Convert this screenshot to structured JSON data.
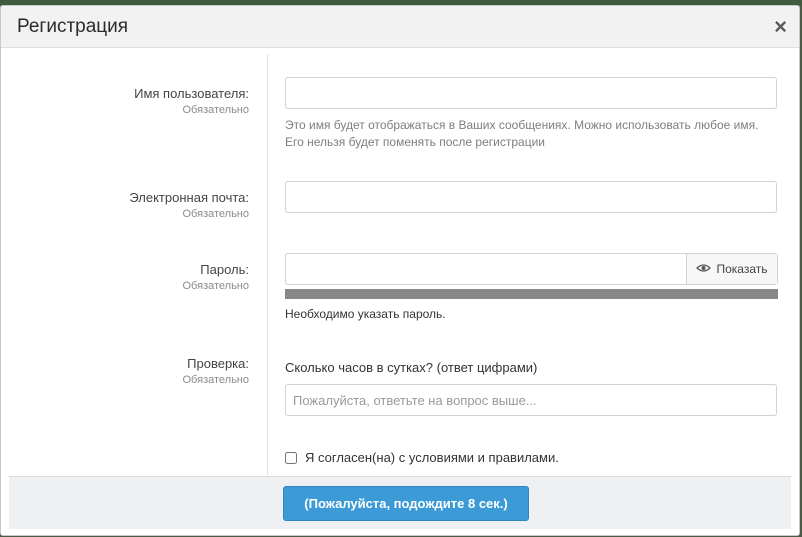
{
  "dialog": {
    "title": "Регистрация",
    "close_symbol": "×"
  },
  "fields": {
    "username": {
      "label": "Имя пользователя:",
      "required": "Обязательно",
      "value": "",
      "hint": "Это имя будет отображаться в Ваших сообщениях. Можно использовать любое имя. Его нельзя будет поменять после регистрации"
    },
    "email": {
      "label": "Электронная почта:",
      "required": "Обязательно",
      "value": ""
    },
    "password": {
      "label": "Пароль:",
      "required": "Обязательно",
      "value": "",
      "show_label": "Показать",
      "message": "Необходимо указать пароль.",
      "strength_color": "#888888"
    },
    "verification": {
      "label": "Проверка:",
      "required": "Обязательно",
      "question": "Сколько часов в сутках? (ответ цифрами)",
      "placeholder": "Пожалуйста, ответьте на вопрос выше...",
      "value": ""
    }
  },
  "agree": {
    "label": "Я согласен(на) с условиями и правилами.",
    "checked": false
  },
  "submit": {
    "label": "(Пожалуйста, подождите 8 сек.)",
    "color": "#3c9ad6"
  },
  "icons": {
    "close": "close-icon",
    "show": "eye-icon"
  }
}
